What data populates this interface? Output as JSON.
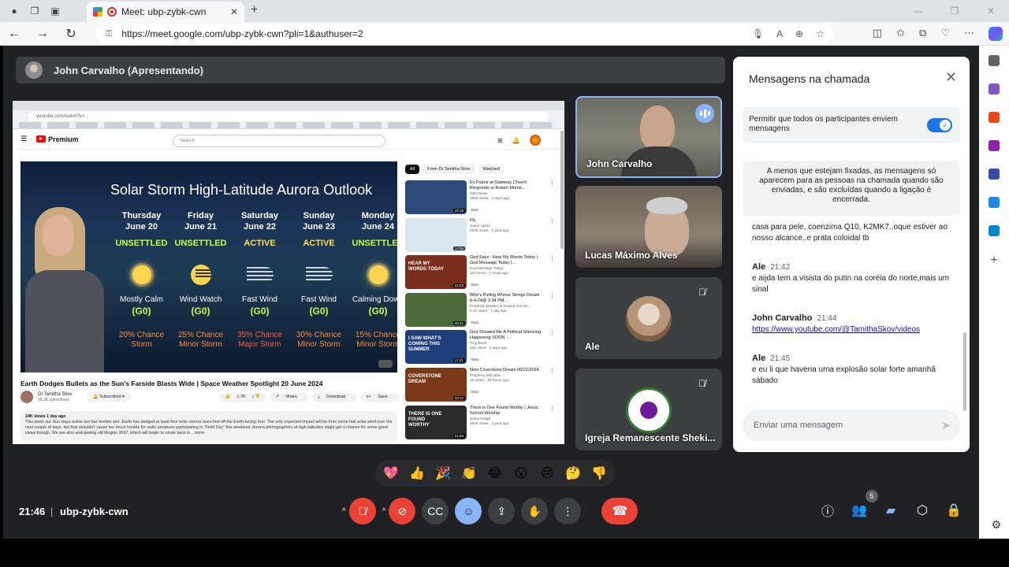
{
  "browser": {
    "tab_title": "Meet: ubp-zybk-cwn",
    "tab_close": "✕",
    "new_tab": "+",
    "url": "https://meet.google.com/ubp-zybk-cwn?pli=1&authuser=2"
  },
  "meet": {
    "presenter_label": "John Carvalho (Apresentando)",
    "shared": {
      "page": {
        "url": "youtube.com/watch?v=...",
        "yt_brand": "Premium",
        "search_placeholder": "Search",
        "video_title": "Earth Dodges Bullets as the Sun's Farside Blasts Wide | Space Weather Spotlight 20 June 2024",
        "channel": "Dr.Tamitha Skov",
        "subscribers": "59.3K subscribers",
        "subscribed_label": "Subscribed",
        "likes": "1.7K",
        "share": "Share",
        "download": "Download",
        "save": "Save",
        "desc_meta": "24K views  1 day ago",
        "description": "This week our Sun stays active but has terrible aim. Earth has dodged at least four solar storms launched off the Earth-facing Sun. The only expected impact will be from some fast solar wind over the next couple of days, but that shouldn't cause too much trouble for radio amateurs participating in \"Field Day\" this weekend. Aurora photographers at high latitudes might get a chance for some good views though. We are also anticipating old Region 3697, which will begin to rotate back in ...more",
        "chips": [
          "All",
          "From Dr.Tamitha Skov",
          "Watched"
        ],
        "related": [
          {
            "title": "Ex Pastor at Gateway Church Responds to Robert Morris...",
            "channel": "CBN News",
            "views": "398K views · 3 days ago",
            "badge": "New",
            "dur": "34:19",
            "color": "#2b4a7a"
          },
          {
            "title": "Fly",
            "channel": "Jason Upton",
            "views": "210K views · 1 year ago",
            "badge": "",
            "dur": "12:58",
            "color": "#d9e6ee"
          },
          {
            "title": "God Says : Hear My Words Today | God Message Today |...",
            "channel": "God Message Today",
            "views": "120 views · 7 hours ago",
            "badge": "New",
            "dur": "24:03",
            "color": "#7a2e1e"
          },
          {
            "title": "Who's Pulling Whose Strings Dream 6-4-24@ 3:34 PM...",
            "channel": "Prophetic Dreams & Visions from M...",
            "views": "5.1K views · 1 day ago",
            "badge": "New",
            "dur": "49:21",
            "color": "#4b6b3a"
          },
          {
            "title": "God Showed Me A Political Silencing Happening SOON -...",
            "channel": "Troy Black",
            "views": "43K views · 2 days ago",
            "badge": "New",
            "dur": "17:41",
            "color": "#1f3f7a"
          },
          {
            "title": "New Coverstone Dream 06/21/2024",
            "channel": "Prophecy with Stan",
            "views": "3K views · 18 hours ago",
            "badge": "New",
            "dur": "33:12",
            "color": "#7a3a1a"
          },
          {
            "title": "There is One Found Worthy | Jesus School Worship",
            "channel": "Jesus Image",
            "views": "264K views · 1 year ago",
            "badge": "",
            "dur": "21:58",
            "color": "#2a2a2a"
          }
        ],
        "thumb_texts": [
          "",
          "",
          "HEAR MY WORDS TODAY",
          "",
          "I SAW WHAT'S COMING THIS SUMMER",
          "COVERSTONE DREAM",
          "THERE IS ONE FOUND WORTHY"
        ]
      },
      "video": {
        "title": "Solar Storm High-Latitude Aurora Outlook",
        "days": [
          {
            "day": "Thursday",
            "date": "June 20",
            "status": "UNSETTLED",
            "status_color": "#c6ff3d",
            "icon": "sun",
            "cond": "Mostly Calm",
            "g": "(G0)",
            "g_color": "#c6ff3d",
            "chance": "20% Chance",
            "storm": "Storm",
            "chance_color": "#ff8a3d"
          },
          {
            "day": "Friday",
            "date": "June 21",
            "status": "UNSETTLED",
            "status_color": "#c6ff3d",
            "icon": "sunwind",
            "cond": "Wind Watch",
            "g": "(G0)",
            "g_color": "#c6ff3d",
            "chance": "25% Chance",
            "storm": "Minor Storm",
            "chance_color": "#ff8a3d"
          },
          {
            "day": "Saturday",
            "date": "June 22",
            "status": "ACTIVE",
            "status_color": "#ffe14d",
            "icon": "wind",
            "cond": "Fast Wind",
            "g": "(G0)",
            "g_color": "#c6ff3d",
            "chance": "35% Chance",
            "storm": "Major Storm",
            "chance_color": "#ff5b3d"
          },
          {
            "day": "Sunday",
            "date": "June 23",
            "status": "ACTIVE",
            "status_color": "#ffe14d",
            "icon": "wind",
            "cond": "Fast Wind",
            "g": "(G0)",
            "g_color": "#c6ff3d",
            "chance": "30% Chance",
            "storm": "Minor Storm",
            "chance_color": "#ff8a3d"
          },
          {
            "day": "Monday",
            "date": "June 24",
            "status": "UNSETTLED",
            "status_color": "#c6ff3d",
            "icon": "sun",
            "cond": "Calming Down",
            "g": "(G0)",
            "g_color": "#c6ff3d",
            "chance": "15% Chance",
            "storm": "Minor Storm",
            "chance_color": "#ff8a3d"
          }
        ]
      }
    },
    "participants": [
      {
        "name": "John Carvalho",
        "speaking": true
      },
      {
        "name": "Lucas Máximo Alves",
        "speaking": false
      },
      {
        "name": "Ale",
        "muted": true
      },
      {
        "name": "Igreja Remanescente Sheki...",
        "muted": true
      }
    ],
    "chat": {
      "title": "Mensagens na chamada",
      "permit_text": "Permitir que todos os participantes enviem mensagens",
      "notice": "A menos que estejam fixadas, as mensagens só aparecem para as pessoas na chamada quando são enviadas, e são excluídas quando a ligação é encerrada.",
      "partial": "casa para pele, coenzima Q10, K2MK7..oque estiver ao nosso alcance..e prata coloidal tb",
      "messages": [
        {
          "author": "Ale",
          "time": "21:42",
          "text": "e aijda tem a visista do putin na coréia do norte,mais um sinal",
          "link": false
        },
        {
          "author": "John Carvalho",
          "time": "21:44",
          "text": "https://www.youtube.com/@TamithaSkov/videos",
          "link": true
        },
        {
          "author": "Ale",
          "time": "21:45",
          "text": "e eu li que haveria uma explosão solar forte amanhã sábado",
          "link": false
        }
      ],
      "input_placeholder": "Enviar uma mensagem"
    },
    "reactions": [
      "💖",
      "👍",
      "🎉",
      "👏",
      "😂",
      "😮",
      "😢",
      "🤔",
      "👎"
    ],
    "bottom": {
      "time": "21:46",
      "separator": "|",
      "meeting_code": "ubp-zybk-cwn",
      "participant_count": "5"
    }
  }
}
